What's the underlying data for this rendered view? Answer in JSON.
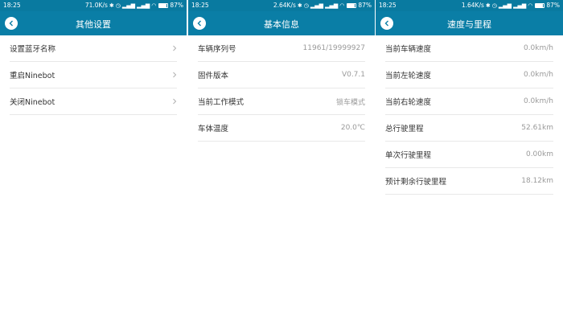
{
  "colors": {
    "header": "#0a7ea6",
    "statusbar": "#097aa0",
    "text": "#333333",
    "value": "#9a9a9a"
  },
  "screens": [
    {
      "status": {
        "time": "18:25",
        "speed": "71.0K/s",
        "battery": "87%",
        "battery_level": 0.87
      },
      "title": "其他设置",
      "rows": [
        {
          "label": "设置蓝牙名称"
        },
        {
          "label": "重启Ninebot"
        },
        {
          "label": "关闭Ninebot"
        }
      ]
    },
    {
      "status": {
        "time": "18:25",
        "speed": "2.64K/s",
        "battery": "87%",
        "battery_level": 0.87
      },
      "title": "基本信息",
      "rows": [
        {
          "label": "车辆序列号",
          "value": "11961/19999927"
        },
        {
          "label": "固件版本",
          "value": "V0.7.1"
        },
        {
          "label": "当前工作模式",
          "value": "锁车模式"
        },
        {
          "label": "车体温度",
          "value": "20.0℃"
        }
      ]
    },
    {
      "status": {
        "time": "18:25",
        "speed": "1.64K/s",
        "battery": "87%",
        "battery_level": 0.87
      },
      "title": "速度与里程",
      "rows": [
        {
          "label": "当前车辆速度",
          "value": "0.0km/h"
        },
        {
          "label": "当前左轮速度",
          "value": "0.0km/h"
        },
        {
          "label": "当前右轮速度",
          "value": "0.0km/h"
        },
        {
          "label": "总行驶里程",
          "value": "52.61km"
        },
        {
          "label": "单次行驶里程",
          "value": "0.00km"
        },
        {
          "label": "预计剩余行驶里程",
          "value": "18.12km"
        }
      ]
    }
  ]
}
